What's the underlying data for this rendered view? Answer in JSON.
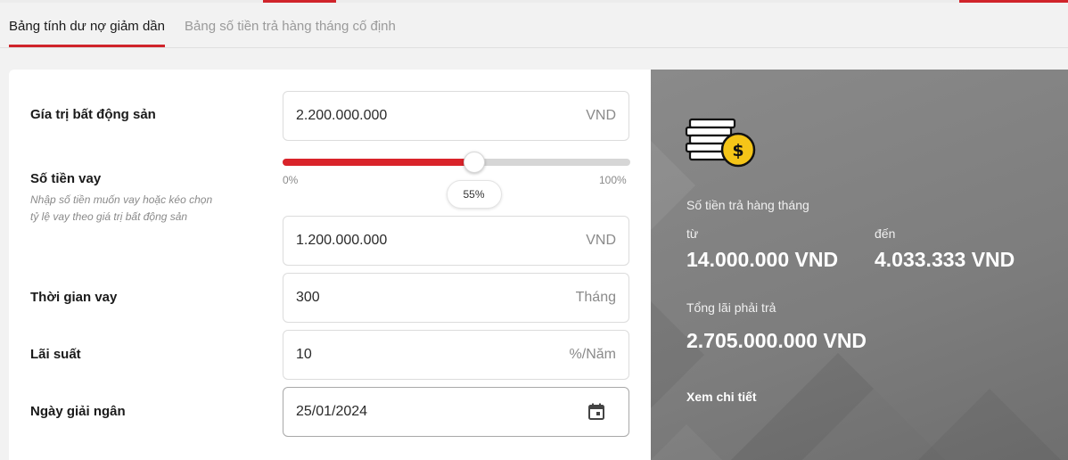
{
  "tabs": [
    {
      "label": "Bảng tính dư nợ giảm dần",
      "active": true
    },
    {
      "label": "Bảng số tiền trả hàng tháng cố định",
      "active": false
    }
  ],
  "form": {
    "property_value": {
      "label": "Gía trị bất động sản",
      "value": "2.200.000.000",
      "unit": "VND"
    },
    "loan_amount": {
      "label": "Số tiền vay",
      "hint": "Nhập số tiền muốn vay hoặc kéo chọn tỷ lệ vay theo giá trị bất động sản",
      "value": "1.200.000.000",
      "unit": "VND",
      "slider": {
        "min_label": "0%",
        "max_label": "100%",
        "value_label": "55%",
        "fraction": 0.55
      }
    },
    "loan_term": {
      "label": "Thời gian vay",
      "value": "300",
      "unit": "Tháng"
    },
    "interest_rate": {
      "label": "Lãi suất",
      "value": "10",
      "unit": "%/Năm"
    },
    "disbursement_date": {
      "label": "Ngày giải ngân",
      "value": "25/01/2024",
      "icon": "calendar-icon"
    }
  },
  "result": {
    "icon": "coins-dollar-icon",
    "monthly_label": "Số tiền trả hàng tháng",
    "from_label": "từ",
    "to_label": "đến",
    "from_value": "14.000.000 VND",
    "to_value": "4.033.333 VND",
    "total_interest_label": "Tổng lãi phải trả",
    "total_interest_value": "2.705.000.000 VND",
    "detail_link": "Xem chi tiết"
  },
  "colors": {
    "accent": "#d0242b",
    "panel": "#7d7d7d",
    "coin": "#f5c518"
  }
}
